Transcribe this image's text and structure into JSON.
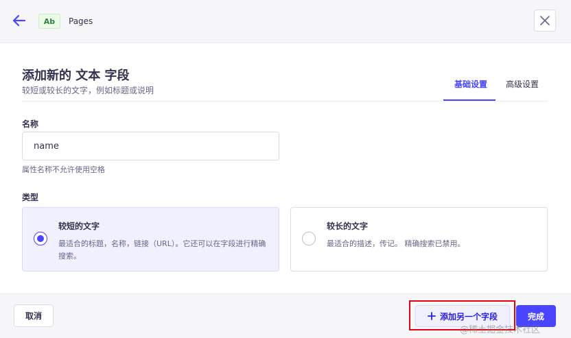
{
  "header": {
    "badge": "Ab",
    "title": "Pages"
  },
  "dialog": {
    "title": "添加新的 文本 字段",
    "subtitle": "较短或较长的文字，例如标题或说明"
  },
  "tabs": [
    {
      "label": "基础设置",
      "active": true
    },
    {
      "label": "高级设置",
      "active": false
    }
  ],
  "name_field": {
    "label": "名称",
    "value": "name",
    "hint": "属性名称不允许使用空格"
  },
  "type_field": {
    "label": "类型",
    "options": [
      {
        "title": "较短的文字",
        "description": "最适合的标题，名称，链接（URL）。它还可以在字段进行精确搜索。",
        "selected": true
      },
      {
        "title": "较长的文字",
        "description": "最适合的描述，传记。 精确搜索已禁用。",
        "selected": false
      }
    ]
  },
  "footer": {
    "cancel_label": "取消",
    "add_another_label": "添加另一个字段",
    "finish_label": "完成"
  },
  "watermark": "@稀土掘金技术社区",
  "colors": {
    "accent": "#4945ff",
    "highlight": "#e3000f",
    "badge_green": "#328048"
  }
}
